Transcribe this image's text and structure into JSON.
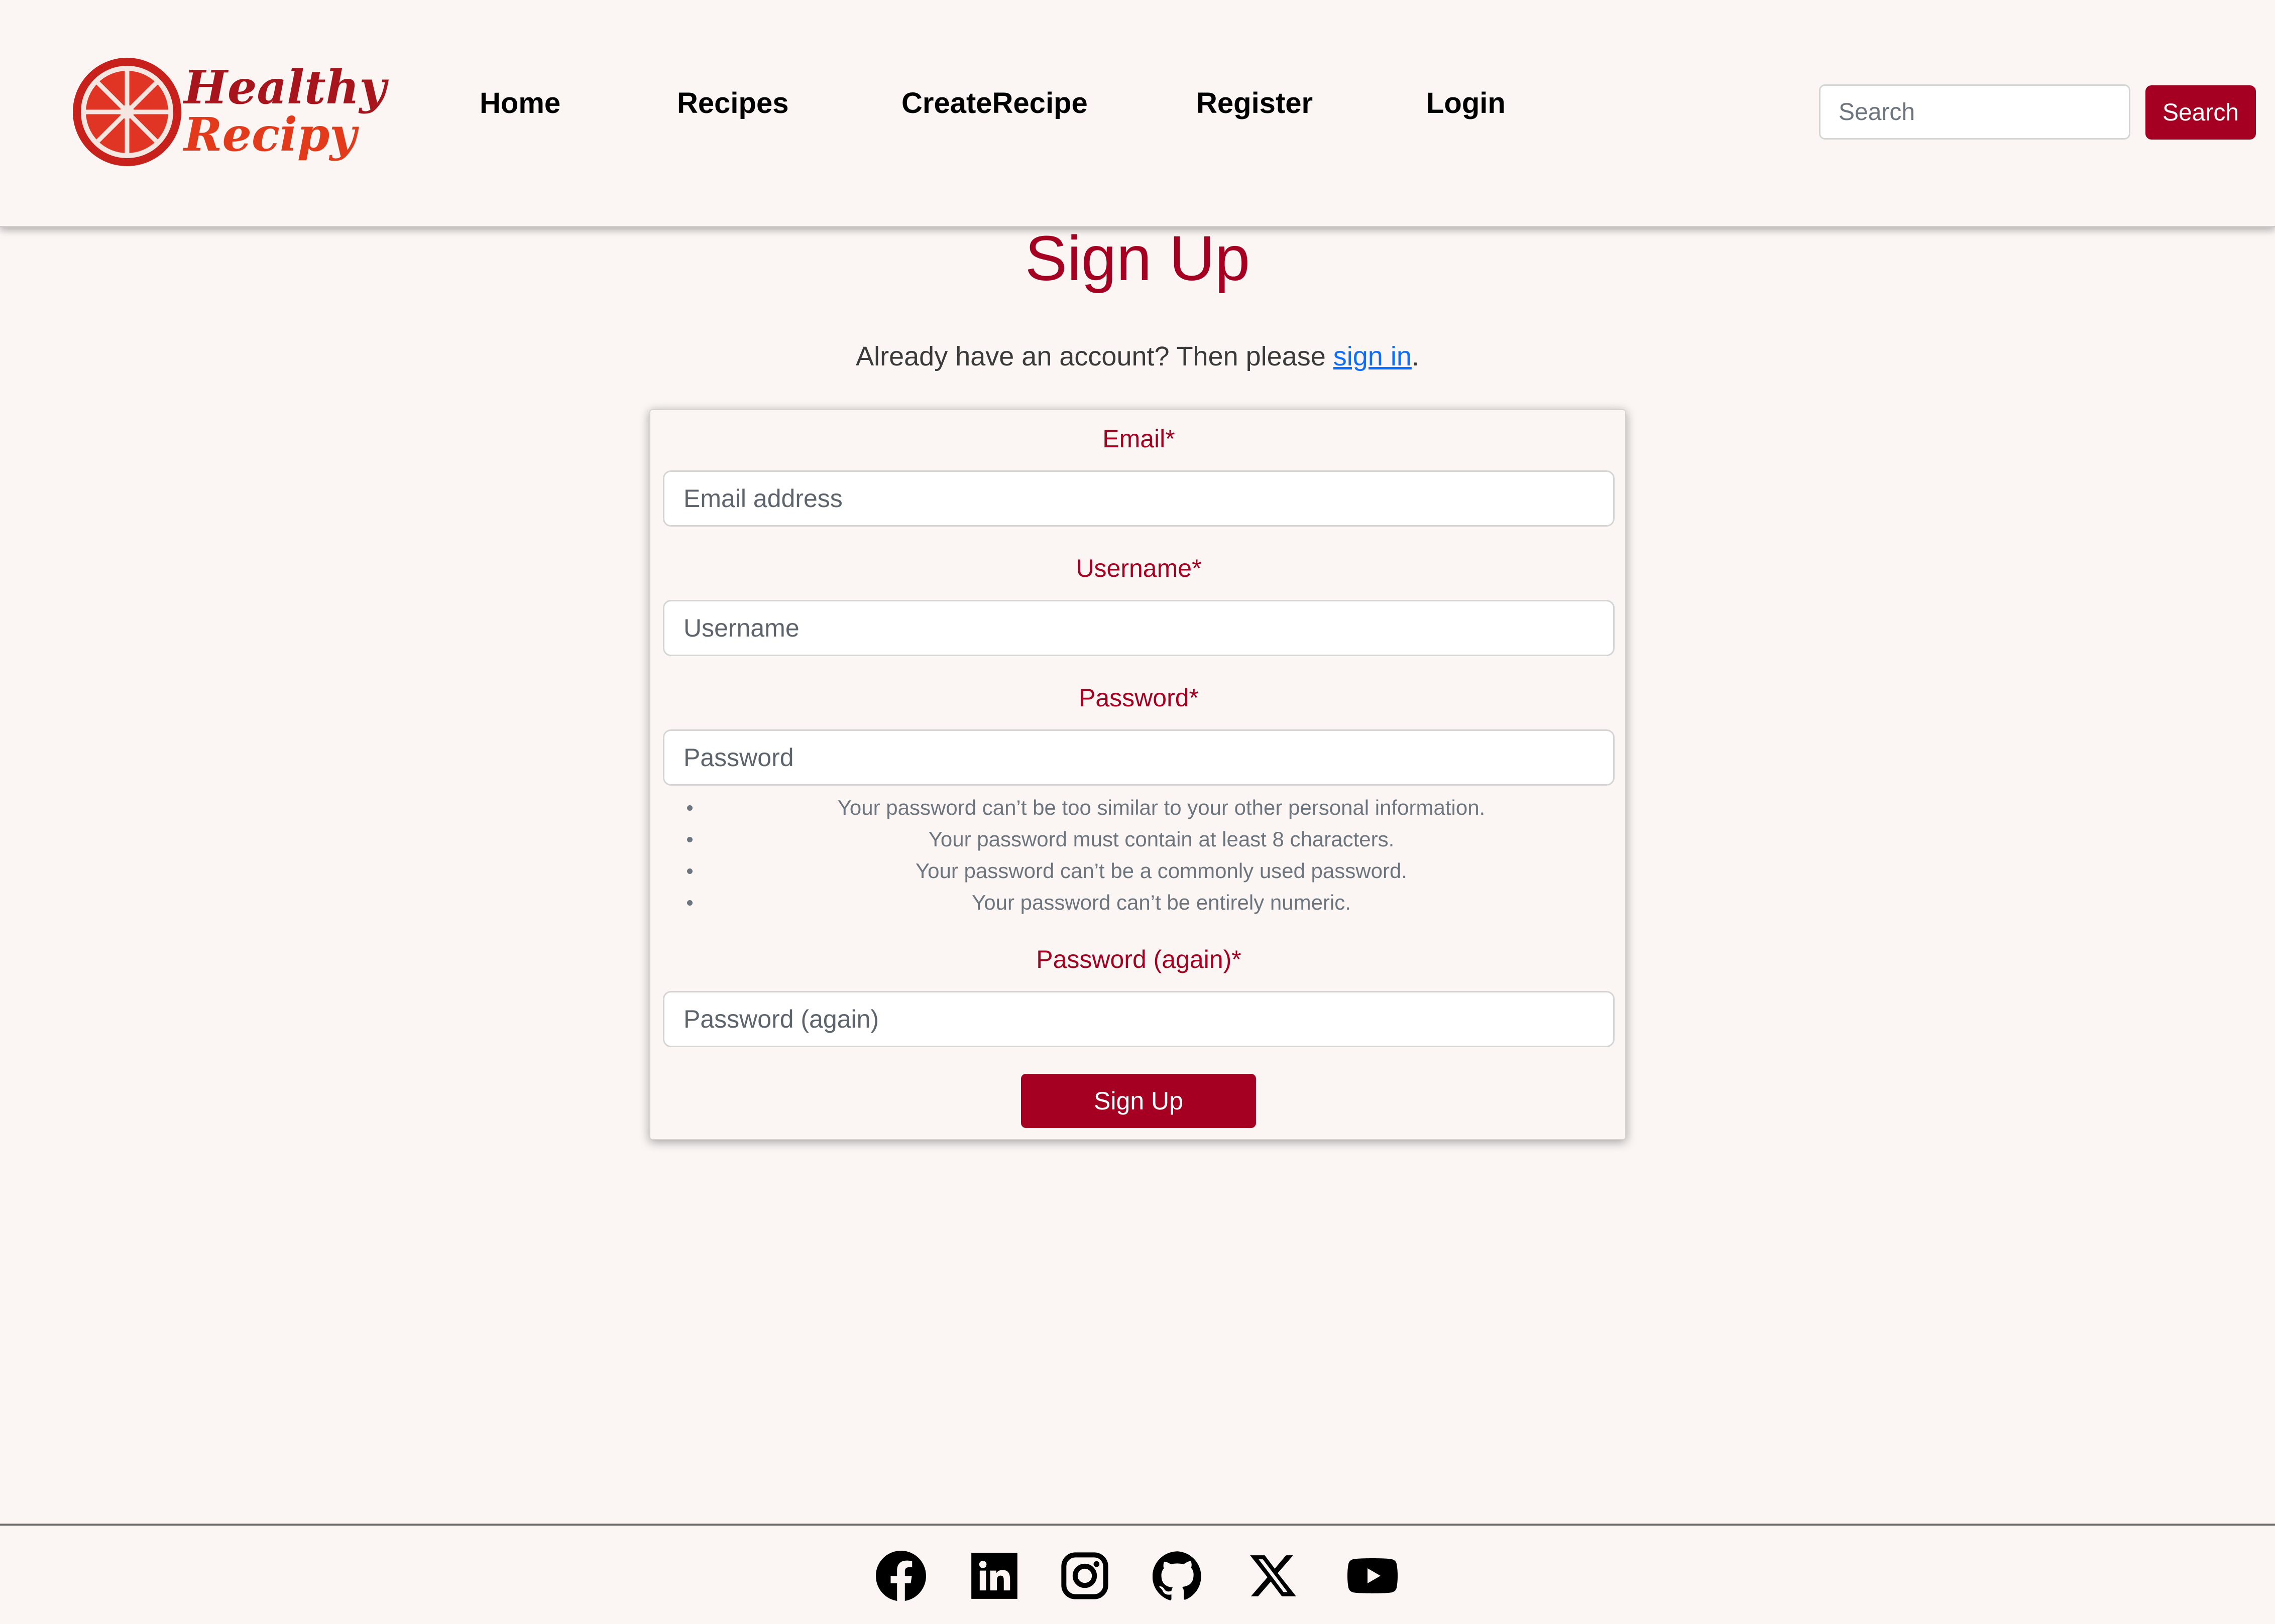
{
  "brand": {
    "line1": "Healthy",
    "line2": "Recipy",
    "logo_icon": "orange-slice-icon"
  },
  "nav": {
    "items": [
      {
        "label": "Home"
      },
      {
        "label": "Recipes"
      },
      {
        "label": "CreateRecipe"
      },
      {
        "label": "Register"
      },
      {
        "label": "Login"
      }
    ]
  },
  "search": {
    "placeholder": "Search",
    "value": "",
    "button_label": "Search"
  },
  "page": {
    "title": "Sign Up",
    "subtitle_prefix": "Already have an account? Then please ",
    "subtitle_link": "sign in",
    "subtitle_suffix": "."
  },
  "form": {
    "email": {
      "label": "Email*",
      "placeholder": "Email address",
      "value": ""
    },
    "username": {
      "label": "Username*",
      "placeholder": "Username",
      "value": ""
    },
    "password": {
      "label": "Password*",
      "placeholder": "Password",
      "value": ""
    },
    "password_help": [
      "Your password can’t be too similar to your other personal information.",
      "Your password must contain at least 8 characters.",
      "Your password can’t be a commonly used password.",
      "Your password can’t be entirely numeric."
    ],
    "password2": {
      "label": "Password (again)*",
      "placeholder": "Password (again)",
      "value": ""
    },
    "submit_label": "Sign Up"
  },
  "footer": {
    "social": [
      "facebook-icon",
      "linkedin-icon",
      "instagram-icon",
      "github-icon",
      "x-icon",
      "youtube-icon"
    ]
  },
  "colors": {
    "accent": "#a50021",
    "background": "#fbf6f4",
    "link": "#0d6efd",
    "logo_red": "#d42a1e"
  }
}
